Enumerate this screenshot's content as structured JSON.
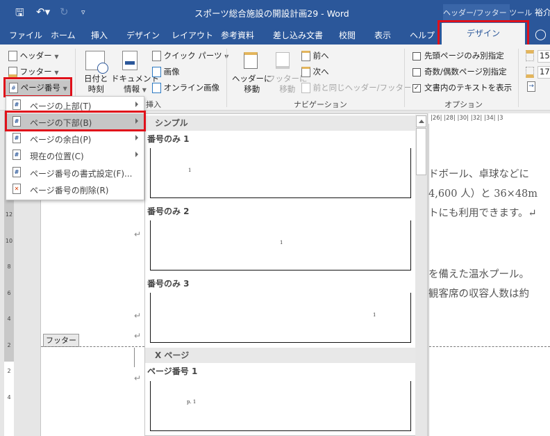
{
  "titlebar": {
    "document_title": "スポーツ総合施設の開設計画29  -  Word",
    "context_tool": "ヘッダー/フッター ツール",
    "user": "裕介"
  },
  "tabs": [
    {
      "label": "ファイル"
    },
    {
      "label": "ホーム"
    },
    {
      "label": "挿入"
    },
    {
      "label": "デザイン"
    },
    {
      "label": "レイアウト"
    },
    {
      "label": "参考資料"
    },
    {
      "label": "差し込み文書"
    },
    {
      "label": "校閲"
    },
    {
      "label": "表示"
    },
    {
      "label": "ヘルプ"
    }
  ],
  "active_tab": {
    "label": "デザイン"
  },
  "ribbon": {
    "header": "ヘッダー",
    "footer": "フッター",
    "page_number": "ページ番号",
    "date_time_1": "日付と",
    "date_time_2": "時刻",
    "doc_info_1": "ドキュメント",
    "doc_info_2": "情報",
    "quick_parts": "クイック パーツ",
    "picture": "画像",
    "online_picture": "オンライン画像",
    "insert_group": "挿入",
    "goto_header_1": "ヘッダーに",
    "goto_header_2": "移動",
    "goto_footer_1": "フッターに",
    "goto_footer_2": "移動",
    "previous": "前へ",
    "next": "次へ",
    "link_previous": "前と同じヘッダー/フッター",
    "nav_group": "ナビゲーション",
    "opt_first_page": "先頭ページのみ別指定",
    "opt_odd_even": "奇数/偶数ページ別指定",
    "opt_show_text": "文書内のテキストを表示",
    "opt_show_text_checked": true,
    "options_group": "オプション",
    "header_pos": "15",
    "footer_pos": "17"
  },
  "menu": {
    "items": [
      {
        "label": "ページの上部(T)",
        "submenu": true
      },
      {
        "label": "ページの下部(B)",
        "submenu": true,
        "highlighted": true
      },
      {
        "label": "ページの余白(P)",
        "submenu": true
      },
      {
        "label": "現在の位置(C)",
        "submenu": true
      },
      {
        "label": "ページ番号の書式設定(F)...",
        "submenu": false
      },
      {
        "label": "ページ番号の削除(R)",
        "submenu": false
      }
    ]
  },
  "gallery": {
    "section_simple": "シンプル",
    "section_xpage": "X ページ",
    "items": [
      {
        "name": "番号のみ 1",
        "preview_text": "1",
        "align": "left"
      },
      {
        "name": "番号のみ 2",
        "preview_text": "1",
        "align": "center"
      },
      {
        "name": "番号のみ 3",
        "preview_text": "1",
        "align": "right"
      },
      {
        "name": "ページ番号 1",
        "preview_text": "p. 1",
        "align": "left"
      }
    ]
  },
  "ruler": {
    "horizontal": "|26|   |28|   |30|   |32|   |34|   |3",
    "vertical": [
      "12",
      "10",
      "8",
      "6",
      "4",
      "2",
      "",
      "2",
      "4"
    ]
  },
  "document": {
    "lines": [
      "ドボール、卓球などに",
      "4,600 人）と 36×48m",
      "トにも利用できます。↵",
      "を備えた温水プール。",
      "観客席の収容人数は約"
    ],
    "footer_label": "フッター"
  },
  "colors": {
    "brand": "#2b579a",
    "highlight_box": "#e0101a"
  }
}
